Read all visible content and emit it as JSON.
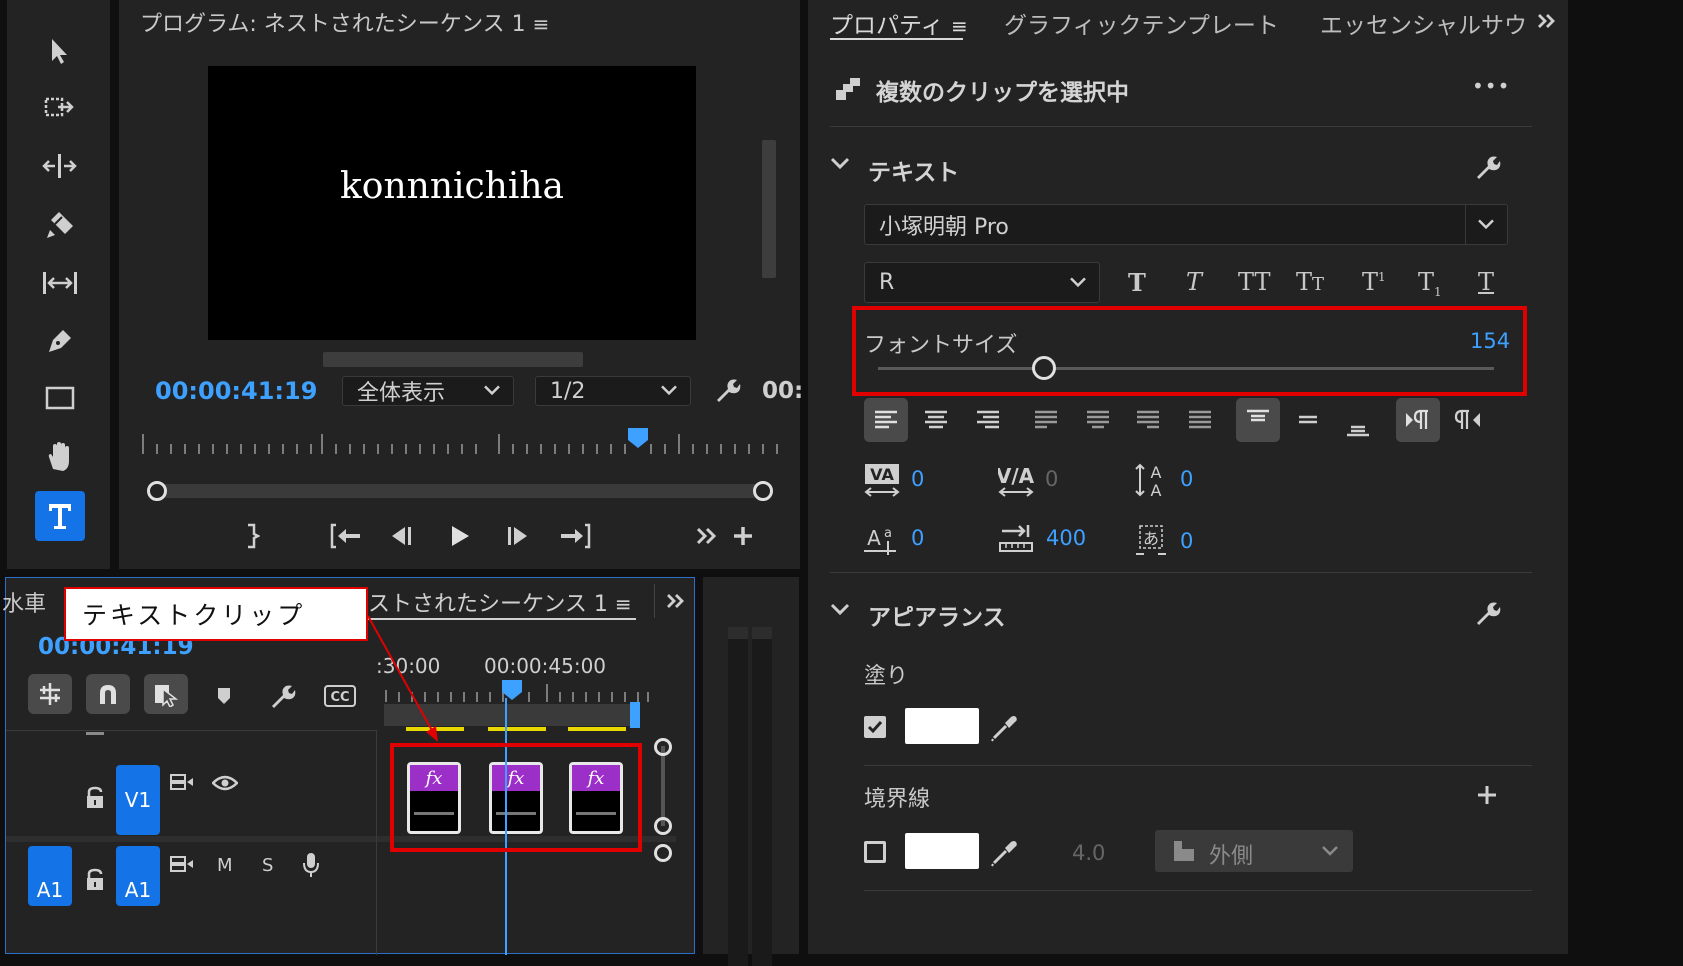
{
  "program_monitor": {
    "title": "プログラム: ネストされたシーケンス 1",
    "preview_text": "konnnichiha",
    "timecode": "00:00:41:19",
    "fit_select": "全体表示",
    "resolution_select": "1/2",
    "end_timecode_partial": "00:"
  },
  "properties": {
    "tabs": [
      "プロパティ",
      "グラフィックテンプレート",
      "エッセンシャルサウ:"
    ],
    "selection_title": "複数のクリップを選択中",
    "text_section": "テキスト",
    "font_family": "小塚明朝 Pro",
    "font_style": "R",
    "font_size_label": "フォントサイズ",
    "font_size_value": "154",
    "font_size_fraction": 0.27,
    "kerning": "0",
    "tracking": "0",
    "leading": "0",
    "baseline_shift": "0",
    "tab_width": "400",
    "tsume": "0",
    "appearance_section": "アピアランス",
    "fill_label": "塗り",
    "fill_color": "#ffffff",
    "stroke_label": "境界線",
    "stroke_color": "#ffffff",
    "stroke_width": "4.0",
    "stroke_position": "外側",
    "more": "•••"
  },
  "timeline": {
    "left_tab_partial": "水車",
    "sequence_tab": "ストされたシーケンス 1",
    "timecode": "00:00:41:19",
    "ruler_labels": [
      ":30:00",
      "00:00:45:00"
    ],
    "tracks": {
      "v1": "V1",
      "a1_source": "A1",
      "a1_target": "A1",
      "mute": "M",
      "solo": "S"
    },
    "clip_label": "fx"
  },
  "annotation": {
    "callout_text": "テキストクリップ",
    "highlight_color": "#e00000"
  },
  "colors": {
    "accent": "#1473e6",
    "value_blue": "#3ea0ff",
    "clip_purple": "#9b2fc8",
    "marker_yellow": "#e8d800"
  }
}
